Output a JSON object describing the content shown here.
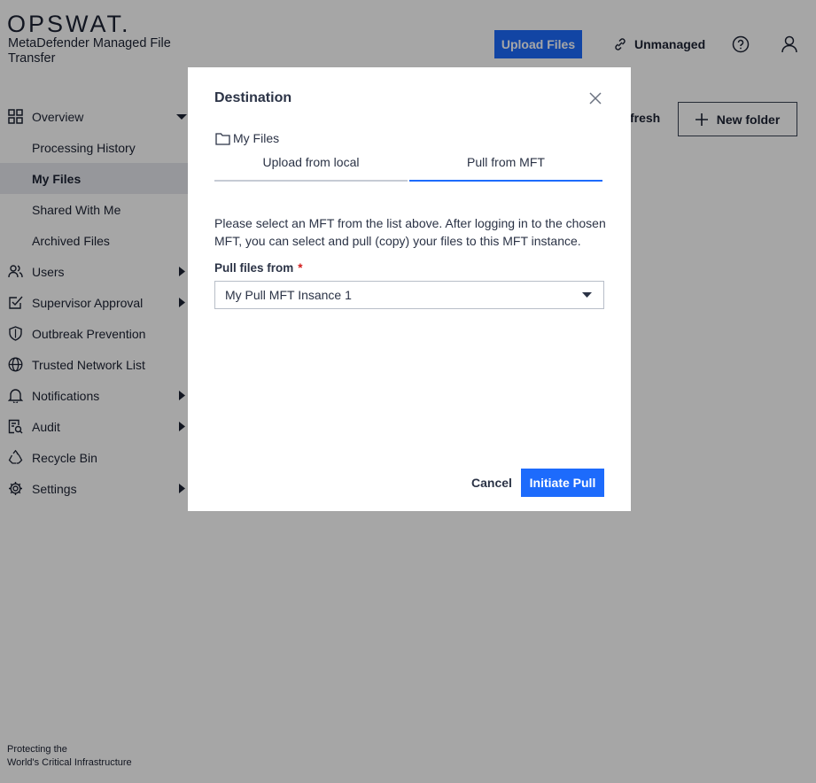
{
  "brand": {
    "logo": "OPSWAT.",
    "product": "MetaDefender Managed File Transfer",
    "tagline_line1": "Protecting the",
    "tagline_line2": "World's Critical Infrastructure"
  },
  "header": {
    "upload_label": "Upload Files",
    "unmanaged_label": "Unmanaged",
    "link_icon": "link-icon",
    "help_icon": "help-circle-icon",
    "user_icon": "user-icon"
  },
  "toolbar": {
    "refresh_label": "fresh",
    "new_folder_label": "New folder"
  },
  "sidebar": {
    "items": [
      {
        "label": "Overview",
        "icon": "grid-icon"
      },
      {
        "label": "Processing History"
      },
      {
        "label": "My Files",
        "active": true
      },
      {
        "label": "Shared With Me"
      },
      {
        "label": "Archived Files"
      },
      {
        "label": "Users",
        "icon": "users-icon"
      },
      {
        "label": "Supervisor Approval",
        "icon": "checkbox-icon"
      },
      {
        "label": "Outbreak Prevention",
        "icon": "shield-icon"
      },
      {
        "label": "Trusted Network List",
        "icon": "globe-icon"
      },
      {
        "label": "Notifications",
        "icon": "bell-icon"
      },
      {
        "label": "Audit",
        "icon": "audit-icon"
      },
      {
        "label": "Recycle Bin",
        "icon": "recycle-icon"
      },
      {
        "label": "Settings",
        "icon": "gear-icon"
      }
    ]
  },
  "modal": {
    "title": "Destination",
    "breadcrumb": "My Files",
    "tabs": [
      {
        "label": "Upload from local",
        "active": false
      },
      {
        "label": "Pull from MFT",
        "active": true
      }
    ],
    "description": "Please select an MFT from the list above. After logging in to the chosen MFT, you can select and pull (copy) your files to this MFT instance.",
    "field_label": "Pull files from",
    "required_mark": "*",
    "selected_value": "My Pull MFT Insance 1",
    "cancel_label": "Cancel",
    "initiate_label": "Initiate Pull"
  },
  "colors": {
    "accent": "#1d6bfc",
    "overlay": "rgba(0,0,0,0.35)",
    "required": "#d21c1c"
  }
}
